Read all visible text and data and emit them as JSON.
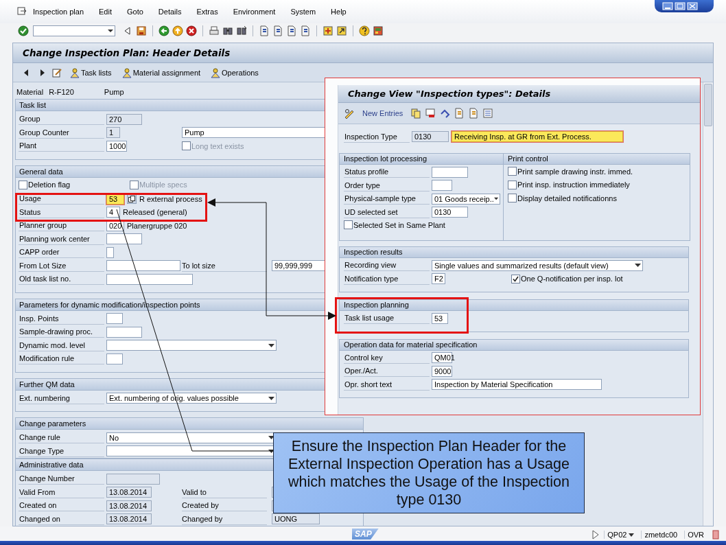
{
  "menu_bar": {
    "items": [
      "Inspection plan",
      "Edit",
      "Goto",
      "Details",
      "Extras",
      "Environment",
      "System",
      "Help"
    ]
  },
  "title": "Change Inspection Plan: Header Details",
  "app_toolbar": [
    "Task lists",
    "Material assignment",
    "Operations"
  ],
  "material": {
    "label": "Material",
    "number": "R-F120",
    "description": "Pump"
  },
  "sections": [
    {
      "title": "Task list",
      "rows": [
        {
          "label": "Group",
          "parts": [
            {
              "kind": "field",
              "value": "270",
              "readonly": true
            }
          ]
        },
        {
          "label": "Group Counter",
          "parts": [
            {
              "kind": "field",
              "value": "1",
              "readonly": true
            }
          ],
          "side": {
            "parts": [
              {
                "kind": "field",
                "value": "Pump"
              }
            ]
          }
        },
        {
          "label": "Plant",
          "parts": [
            {
              "kind": "field",
              "value": "1000"
            }
          ],
          "side": {
            "parts": [
              {
                "kind": "checkbox",
                "label": "Long text exists",
                "checked": false,
                "disabled": true
              }
            ]
          }
        }
      ]
    },
    {
      "title": "General data",
      "rows": [
        {
          "parts": [
            {
              "kind": "checkbox",
              "label": "Deletion flag",
              "checked": false,
              "disabled": false
            },
            {
              "kind": "checkbox",
              "label": "Multiple specs",
              "checked": false,
              "disabled": true
            }
          ]
        },
        {
          "label": "Usage",
          "parts": [
            {
              "kind": "field",
              "value": "53",
              "highlight": true
            },
            {
              "kind": "value_help"
            },
            {
              "kind": "text",
              "text": "R external process"
            }
          ]
        },
        {
          "label": "Status",
          "parts": [
            {
              "kind": "field",
              "value": "4"
            },
            {
              "kind": "text",
              "text": "Released (general)"
            }
          ]
        },
        {
          "label": "Planner group",
          "parts": [
            {
              "kind": "field",
              "value": "020"
            },
            {
              "kind": "text",
              "text": "Planergruppe 020"
            }
          ]
        },
        {
          "label": "Planning work center",
          "parts": [
            {
              "kind": "field"
            }
          ]
        },
        {
          "label": "CAPP order",
          "parts": [
            {
              "kind": "field"
            }
          ]
        },
        {
          "label": "From Lot Size",
          "parts": [
            {
              "kind": "field"
            }
          ],
          "side": {
            "label": "To lot size",
            "parts": [
              {
                "kind": "field",
                "value": "99,999,999"
              }
            ]
          }
        },
        {
          "label": "Old task list no.",
          "parts": [
            {
              "kind": "field"
            }
          ]
        }
      ]
    },
    {
      "title": "Parameters for dynamic modification/inspection points",
      "rows": [
        {
          "label": "Insp. Points",
          "parts": [
            {
              "kind": "field"
            }
          ]
        },
        {
          "label": "Sample-drawing proc.",
          "parts": [
            {
              "kind": "field"
            }
          ]
        },
        {
          "label": "Dynamic mod. level",
          "parts": [
            {
              "kind": "dropdown"
            }
          ]
        },
        {
          "label": "Modification rule",
          "parts": [
            {
              "kind": "field"
            }
          ]
        }
      ]
    },
    {
      "title": "Further QM data",
      "rows": [
        {
          "label": "Ext. numbering",
          "parts": [
            {
              "kind": "dropdown",
              "value": "Ext. numbering of orig. values possible"
            }
          ]
        }
      ]
    },
    {
      "title": "Change parameters",
      "rows": [
        {
          "label": "Change rule",
          "parts": [
            {
              "kind": "dropdown",
              "value": "No"
            }
          ]
        },
        {
          "label": "Change Type",
          "parts": [
            {
              "kind": "dropdown"
            }
          ]
        }
      ]
    },
    {
      "title": "Administrative data",
      "rows": [
        {
          "label": "Change Number",
          "parts": [
            {
              "kind": "field",
              "readonly": true
            }
          ]
        },
        {
          "label": "Valid From",
          "parts": [
            {
              "kind": "field",
              "value": "13.08.2014",
              "readonly": true
            }
          ],
          "side": {
            "label": "Valid to",
            "parts": [
              {
                "kind": "field",
                "readonly": true
              }
            ]
          }
        },
        {
          "label": "Created on",
          "parts": [
            {
              "kind": "field",
              "value": "13.08.2014",
              "readonly": true
            }
          ],
          "side": {
            "label": "Created by",
            "parts": [
              {
                "kind": "field",
                "readonly": true
              }
            ]
          }
        },
        {
          "label": "Changed on",
          "parts": [
            {
              "kind": "field",
              "value": "13.08.2014",
              "readonly": true
            }
          ],
          "side": {
            "label": "Changed by",
            "parts": [
              {
                "kind": "field",
                "value": "UONG",
                "readonly": true
              }
            ]
          }
        }
      ]
    }
  ],
  "popup": {
    "title": "Change View \"Inspection types\": Details",
    "new_entries": "New Entries",
    "inspection_type": {
      "label": "Inspection Type",
      "code": "0130",
      "description": "Receiving Insp. at GR from Ext. Process.",
      "highlight": true
    },
    "groups": [
      {
        "title": "Inspection lot processing",
        "rows": [
          {
            "label": "Status profile",
            "parts": [
              {
                "kind": "field"
              }
            ]
          },
          {
            "label": "Order type",
            "parts": [
              {
                "kind": "field"
              }
            ]
          },
          {
            "label": "Physical-sample type",
            "parts": [
              {
                "kind": "dropdown",
                "value": "01 Goods receip.."
              }
            ]
          },
          {
            "label": "UD selected set",
            "parts": [
              {
                "kind": "field",
                "value": "0130"
              }
            ]
          },
          {
            "parts": [
              {
                "kind": "checkbox",
                "label": "Selected Set in Same Plant",
                "checked": false,
                "disabled": false
              }
            ]
          }
        ]
      },
      {
        "title": "Print control",
        "rows": [
          {
            "parts": [
              {
                "kind": "checkbox",
                "label": "Print sample drawing instr. immed.",
                "checked": false,
                "disabled": false
              }
            ]
          },
          {
            "parts": [
              {
                "kind": "checkbox",
                "label": "Print insp. instruction immediately",
                "checked": false,
                "disabled": false
              }
            ]
          },
          {
            "parts": [
              {
                "kind": "checkbox",
                "label": "Display detailed notificationns",
                "checked": false,
                "disabled": false
              }
            ]
          }
        ]
      },
      {
        "title": "Inspection results",
        "rows": [
          {
            "label": "Recording view",
            "parts": [
              {
                "kind": "dropdown",
                "value": "Single values and summarized results (default view)"
              }
            ]
          },
          {
            "label": "Notification type",
            "parts": [
              {
                "kind": "field",
                "value": "F2"
              }
            ],
            "side": {
              "parts": [
                {
                  "kind": "checkbox",
                  "label": "One Q-notification per insp. lot",
                  "checked": true,
                  "disabled": false
                }
              ]
            }
          }
        ]
      },
      {
        "title": "Inspection planning",
        "rows": [
          {
            "label": "Task list usage",
            "parts": [
              {
                "kind": "field",
                "value": "53"
              }
            ]
          }
        ]
      },
      {
        "title": "Operation data for material specification",
        "rows": [
          {
            "label": "Control key",
            "parts": [
              {
                "kind": "field",
                "value": "QM01"
              }
            ]
          },
          {
            "label": "Oper./Act.",
            "parts": [
              {
                "kind": "field",
                "value": "9000"
              }
            ]
          },
          {
            "label": "Opr. short text",
            "parts": [
              {
                "kind": "field",
                "value": "Inspection by Material Specification"
              }
            ]
          }
        ]
      }
    ]
  },
  "callout": {
    "text": "Ensure the Inspection Plan Header for the External Inspection Operation has a Usage which matches the Usage of the Inspection type 0130"
  },
  "status_bar": {
    "logo": "SAP",
    "items": [
      {
        "kind": "dropdown",
        "text": "QP02"
      },
      {
        "kind": "text",
        "text": "zmetdc00"
      },
      {
        "kind": "text",
        "text": "OVR"
      }
    ]
  }
}
